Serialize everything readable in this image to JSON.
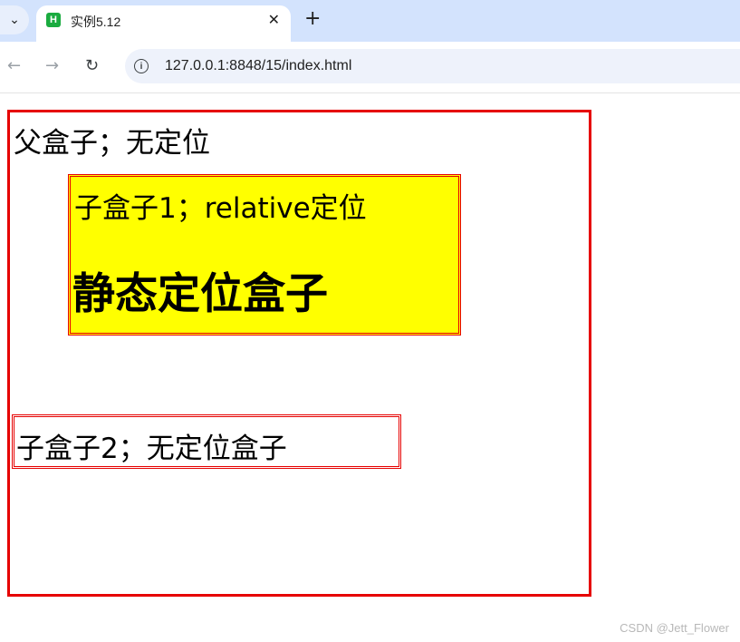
{
  "tab": {
    "favicon_letter": "H",
    "title": "实例5.12",
    "close": "✕",
    "new_tab": "+",
    "menu": "⌄"
  },
  "toolbar": {
    "back": "←",
    "forward": "→",
    "reload": "↻",
    "info": "i",
    "url": "127.0.0.1:8848/15/index.html"
  },
  "page": {
    "father_label": "父盒子；无定位",
    "child1_label": "子盒子1；relative定位",
    "child1_heading": "静态定位盒子",
    "child2_label": "子盒子2；无定位盒子"
  },
  "watermark": "CSDN @Jett_Flower",
  "colors": {
    "border_red": "#e60000",
    "child1_bg": "#ffff00",
    "tabbar_bg": "#d3e3fd"
  }
}
